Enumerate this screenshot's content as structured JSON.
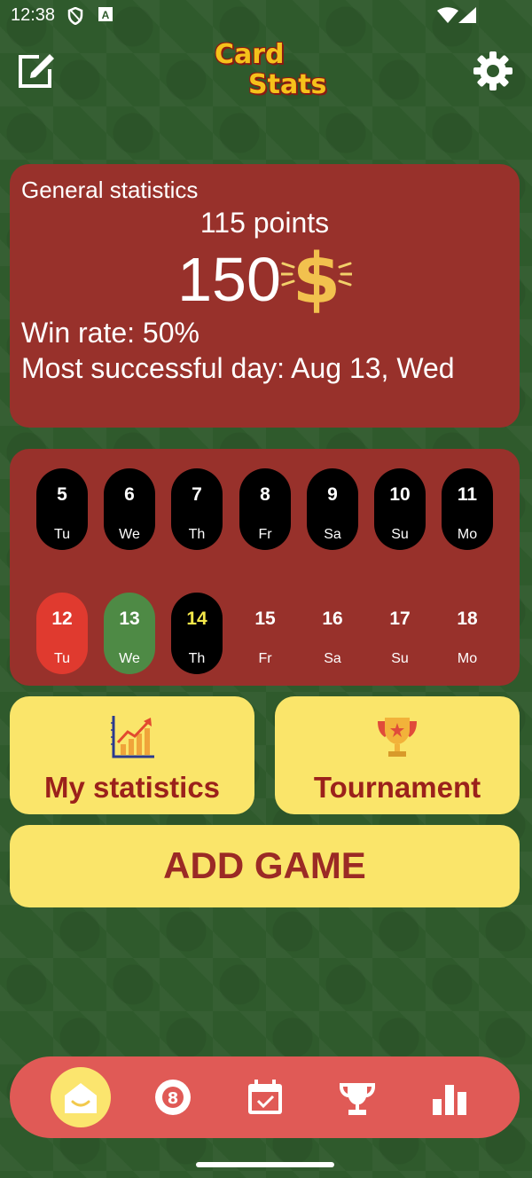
{
  "status_bar": {
    "time": "12:38"
  },
  "header": {
    "logo_line1": "Card",
    "logo_line2": "Stats"
  },
  "general_stats": {
    "title": "General statistics",
    "points": "115 points",
    "money": "150",
    "win_rate": "Win rate: 50%",
    "most_successful_day": "Most successful day: Aug 13, Wed"
  },
  "calendar": {
    "week1": [
      {
        "day": "5",
        "dow": "Tu"
      },
      {
        "day": "6",
        "dow": "We"
      },
      {
        "day": "7",
        "dow": "Th"
      },
      {
        "day": "8",
        "dow": "Fr"
      },
      {
        "day": "9",
        "dow": "Sa"
      },
      {
        "day": "10",
        "dow": "Su"
      },
      {
        "day": "11",
        "dow": "Mo"
      }
    ],
    "week2": [
      {
        "day": "12",
        "dow": "Tu"
      },
      {
        "day": "13",
        "dow": "We"
      },
      {
        "day": "14",
        "dow": "Th"
      },
      {
        "day": "15",
        "dow": "Fr"
      },
      {
        "day": "16",
        "dow": "Sa"
      },
      {
        "day": "17",
        "dow": "Su"
      },
      {
        "day": "18",
        "dow": "Mo"
      }
    ]
  },
  "actions": {
    "my_statistics": "My statistics",
    "tournament": "Tournament",
    "add_game": "ADD GAME"
  },
  "bottom_nav": {
    "items": [
      "home-icon",
      "eight-ball-icon",
      "calendar-icon",
      "trophy-icon",
      "bar-chart-icon"
    ]
  },
  "colors": {
    "background": "#2f5a2c",
    "card": "#98312b",
    "button": "#fae56a",
    "button_text": "#9b211b",
    "nav": "#e05a56",
    "loss_day": "#e03a2f",
    "win_day": "#4e8a45",
    "today_text": "#f5e84a"
  }
}
